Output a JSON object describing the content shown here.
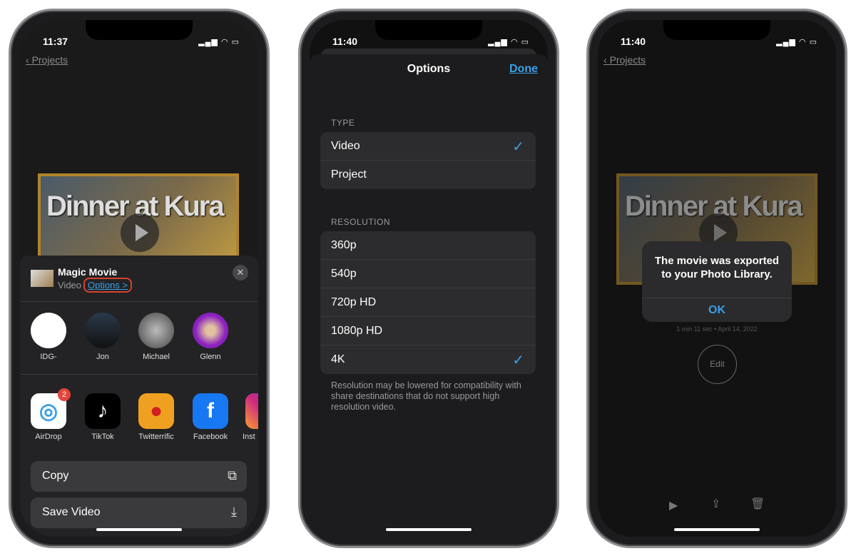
{
  "phone1": {
    "time": "11:37",
    "back": "Projects",
    "movie_title": "Dinner at Kura",
    "share": {
      "title": "Magic Movie",
      "subtitle": "Video",
      "options": "Options >",
      "contacts": [
        {
          "name": "IDG-"
        },
        {
          "name": "Jon"
        },
        {
          "name": "Michael"
        },
        {
          "name": "Glenn"
        }
      ],
      "apps": [
        {
          "name": "AirDrop",
          "badge": "2"
        },
        {
          "name": "TikTok"
        },
        {
          "name": "Twitterrific"
        },
        {
          "name": "Facebook"
        },
        {
          "name": "Inst"
        }
      ],
      "actions": [
        {
          "label": "Copy",
          "icon": "copy-icon"
        },
        {
          "label": "Save Video",
          "icon": "save-icon"
        }
      ]
    }
  },
  "phone2": {
    "time": "11:40",
    "title": "Options",
    "done": "Done",
    "type_header": "TYPE",
    "types": [
      {
        "label": "Video",
        "checked": true
      },
      {
        "label": "Project",
        "checked": false
      }
    ],
    "res_header": "RESOLUTION",
    "resolutions": [
      {
        "label": "360p",
        "checked": false
      },
      {
        "label": "540p",
        "checked": false
      },
      {
        "label": "720p HD",
        "checked": false
      },
      {
        "label": "1080p HD",
        "checked": false
      },
      {
        "label": "4K",
        "checked": true
      }
    ],
    "footnote": "Resolution may be lowered for compatibility with share destinations that do not support high resolution video.",
    "check": "✓"
  },
  "phone3": {
    "time": "11:40",
    "back": "Projects",
    "movie_title": "Dinner at Kura",
    "alert": {
      "message": "The movie was exported to your Photo Library.",
      "ok": "OK"
    },
    "meta": "1 min 11 sec • April 14, 2022",
    "edit": "Edit"
  },
  "colors": {
    "accent": "#3aa0e8",
    "highlight": "#d9432b",
    "frame": "#b0852a"
  }
}
